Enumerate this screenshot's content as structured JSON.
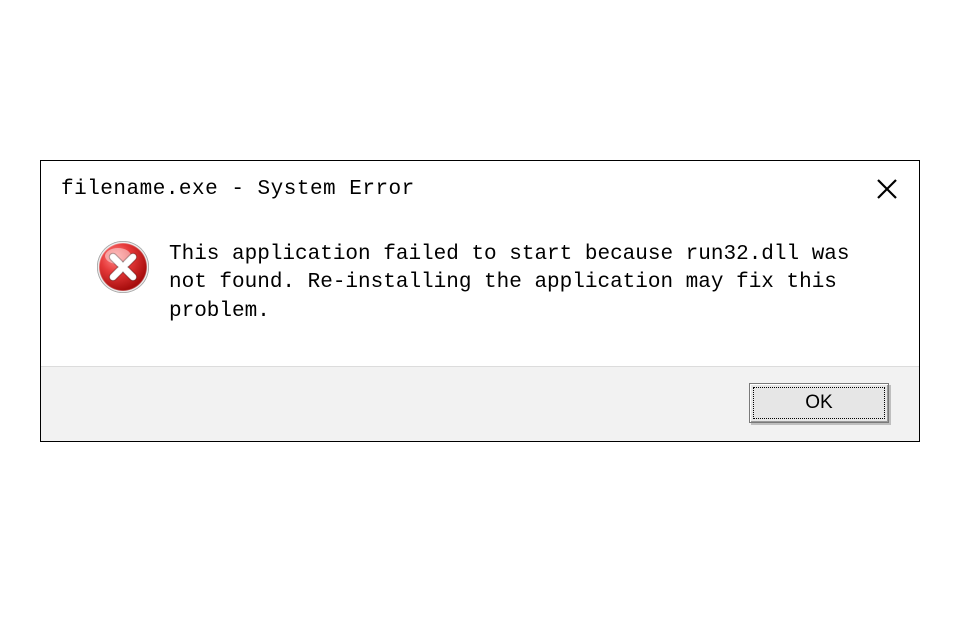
{
  "dialog": {
    "title": "filename.exe - System Error",
    "message": "This application failed to start because run32.dll was not found. Re-installing the application may fix this problem.",
    "ok_label": "OK"
  }
}
